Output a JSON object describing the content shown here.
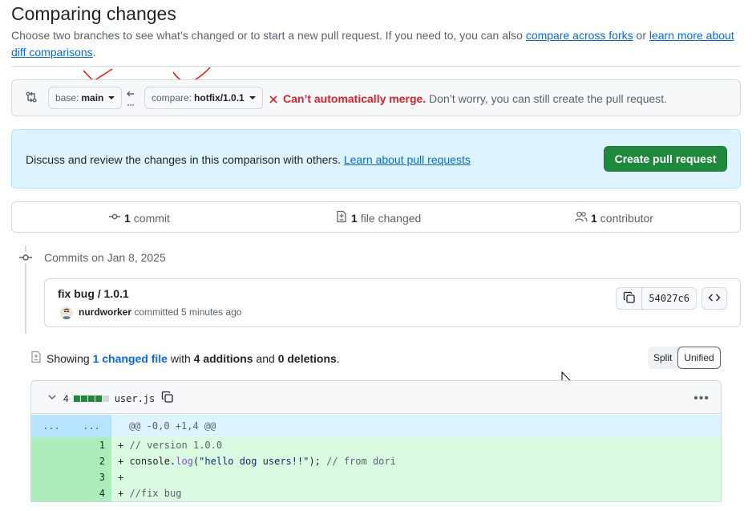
{
  "page": {
    "title": "Comparing changes",
    "description_prefix": "Choose two branches to see what’s changed or to start a new pull request. If you need to, you can also ",
    "link_forks": "compare across forks",
    "desc_or": " or ",
    "link_learn": "learn more about diff comparisons",
    "desc_end": "."
  },
  "compare": {
    "base_label": "base:",
    "base_value": "main",
    "compare_label": "compare:",
    "compare_value": "hotfix/1.0.1",
    "merge_bad": "Can’t automatically merge.",
    "merge_note": " Don’t worry, you can still create the pull request.",
    "bad_color": "#d1242f"
  },
  "banner": {
    "text": "Discuss and review the changes in this comparison with others. ",
    "link": "Learn about pull requests",
    "button": "Create pull request"
  },
  "summary": {
    "commits_count": "1",
    "commits_label": "commit",
    "files_count": "1",
    "files_label": "file changed",
    "contributors_count": "1",
    "contributors_label": "contributor"
  },
  "commits": {
    "date_heading": "Commits on Jan 8, 2025",
    "message": "fix bug / 1.0.1",
    "author": "nurdworker",
    "committed": " committed 5 minutes ago",
    "sha": "54027c6"
  },
  "diff": {
    "showing": "Showing ",
    "changed_files": "1 changed file",
    "with": " with ",
    "additions": "4 additions",
    "and": " and ",
    "deletions": "0 deletions",
    "end": ".",
    "split": "Split",
    "unified": "Unified",
    "file_changes": "4",
    "file_name": "user.js",
    "hunk_left": "...",
    "hunk_right": "...",
    "hunk": "@@ -0,0 +1,4 @@",
    "lines": [
      {
        "num": "1",
        "prefix": "+ ",
        "text": "// version 1.0.0"
      },
      {
        "num": "2",
        "prefix": "+ ",
        "text_a": "console.",
        "text_fn": "log",
        "text_b": "(",
        "text_str": "\"hello dog users!!\"",
        "text_c": "); ",
        "text_cm": "// from dori"
      },
      {
        "num": "3",
        "prefix": "+ ",
        "text": ""
      },
      {
        "num": "4",
        "prefix": "+ ",
        "text": "//fix bug"
      }
    ]
  },
  "colors": {
    "accent": "#0969da",
    "success": "#1f883d",
    "add_bg": "#dafbe1",
    "add_num_bg": "#aceebb",
    "hunk_bg": "#ddf4ff"
  }
}
